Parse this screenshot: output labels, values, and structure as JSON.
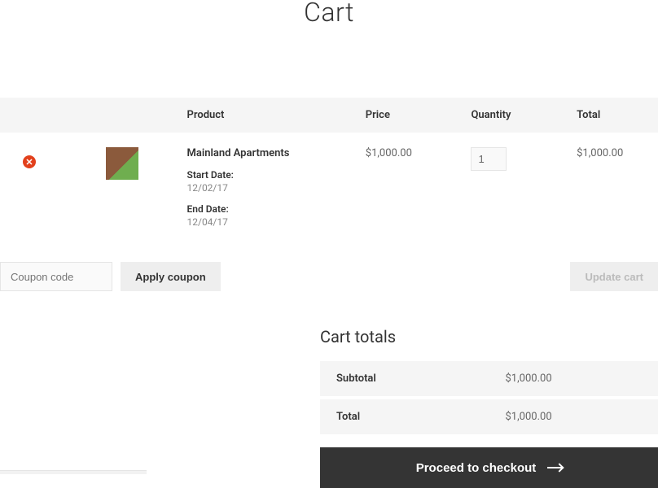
{
  "page": {
    "title": "Cart"
  },
  "cart": {
    "columns": {
      "product": "Product",
      "price": "Price",
      "quantity": "Quantity",
      "total": "Total"
    },
    "item": {
      "name": "Mainland Apartments",
      "start_label": "Start Date:",
      "start_value": "12/02/17",
      "end_label": "End Date:",
      "end_value": "12/04/17",
      "price": "$1,000.00",
      "qty": "1",
      "total": "$1,000.00"
    }
  },
  "coupon": {
    "placeholder": "Coupon code",
    "apply_label": "Apply coupon"
  },
  "update": {
    "label": "Update cart"
  },
  "totals": {
    "title": "Cart totals",
    "subtotal_label": "Subtotal",
    "subtotal_value": "$1,000.00",
    "total_label": "Total",
    "total_value": "$1,000.00"
  },
  "checkout": {
    "label": "Proceed to checkout"
  }
}
